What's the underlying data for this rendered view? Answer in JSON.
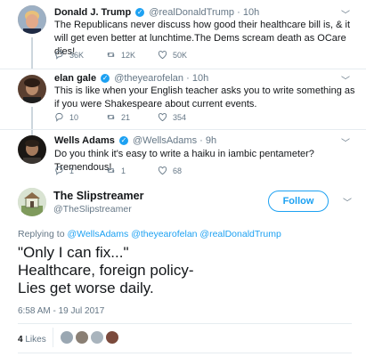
{
  "thread": [
    {
      "name": "Donald J. Trump",
      "handle": "@realDonaldTrump",
      "sep": "·",
      "time": "10h",
      "text": "The Republicans never discuss how good their healthcare bill is, & it will get even better at lunchtime.The Dems scream death as OCare dies!",
      "replies": "36K",
      "retweets": "12K",
      "likes": "50K",
      "verified": true,
      "avatar_color": "#c4a48a"
    },
    {
      "name": "elan gale",
      "handle": "@theyearofelan",
      "sep": "·",
      "time": "10h",
      "text": "This is like when your English teacher asks you to write something as if you were Shakespeare about current events.",
      "replies": "10",
      "retweets": "21",
      "likes": "354",
      "verified": true,
      "avatar_color": "#7a5a48"
    },
    {
      "name": "Wells Adams",
      "handle": "@WellsAdams",
      "sep": "·",
      "time": "9h",
      "text": "Do you think it's easy to write a haiku in iambic pentameter? Tremendous!",
      "replies": "1",
      "retweets": "1",
      "likes": "68",
      "verified": true,
      "avatar_color": "#2e2a26"
    }
  ],
  "main_tweet": {
    "name": "The Slipstreamer",
    "handle": "@TheSlipstreamer",
    "follow_label": "Follow",
    "replying_prefix": "Replying to",
    "mentions": [
      "@WellsAdams",
      "@theyearofelan",
      "@realDonaldTrump"
    ],
    "lines": [
      "\"Only I can fix...\"",
      "Healthcare, foreign policy-",
      "Lies get worse daily."
    ],
    "timestamp": "6:58 AM - 19 Jul 2017",
    "likes_count": "4",
    "likes_label": "Likes",
    "liker_colors": [
      "#9aa7b2",
      "#8a7f74",
      "#a9b4bd",
      "#7b4a3c"
    ]
  },
  "colors": {
    "accent": "#1da1f2",
    "muted": "#657786",
    "divider": "#e6ecf0"
  }
}
